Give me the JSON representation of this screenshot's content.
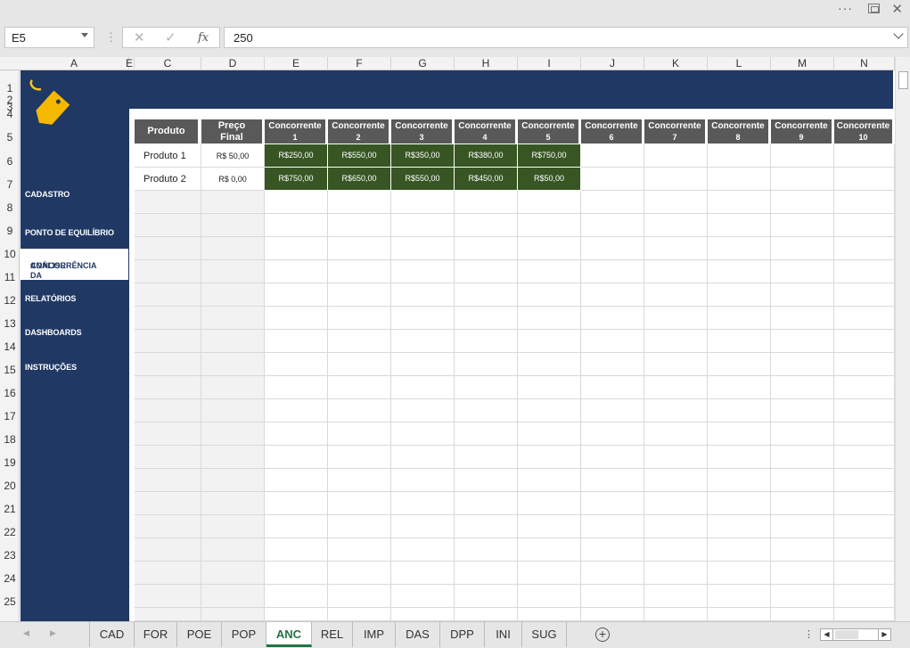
{
  "window": {
    "more": "···",
    "close": "✕"
  },
  "formula": {
    "cell_ref": "E5",
    "cancel": "✕",
    "confirm": "✓",
    "fx": "fx",
    "value": "250"
  },
  "columns": [
    "A",
    "E",
    "C",
    "D",
    "E",
    "F",
    "G",
    "H",
    "I",
    "J",
    "K",
    "L",
    "M",
    "N"
  ],
  "rows": [
    "1",
    "2",
    "3",
    "4",
    "5",
    "6",
    "7",
    "8",
    "9",
    "10",
    "11",
    "12",
    "13",
    "14",
    "15",
    "16",
    "17",
    "18",
    "19",
    "20",
    "21",
    "22",
    "23",
    "24",
    "25"
  ],
  "sidebar": {
    "items": [
      "CADASTRO",
      "PONTO DE EQUILÍBRIO",
      "ANÁLISE DA CONCORRÊNCIA",
      "RELATÓRIOS",
      "DASHBOARDS",
      "INSTRUÇÕES"
    ],
    "active_line1": "ANÁLISE DA",
    "active_line2": "CONCORRÊNCIA",
    "brand_color": "#203864",
    "logo_icon": "price-tag-icon"
  },
  "table": {
    "headers": {
      "produto": "Produto",
      "preco_line1": "Preço",
      "preco_line2": "Final",
      "concorrente": "Concorrente",
      "numbers": [
        "1",
        "2",
        "3",
        "4",
        "5",
        "6",
        "7",
        "8",
        "9",
        "10"
      ]
    },
    "rows": [
      {
        "produto": "Produto 1",
        "preco": "R$ 50,00",
        "concorrentes": [
          "R$250,00",
          "R$550,00",
          "R$350,00",
          "R$380,00",
          "R$750,00"
        ]
      },
      {
        "produto": "Produto 2",
        "preco": "R$ 0,00",
        "concorrentes": [
          "R$750,00",
          "R$650,00",
          "R$550,00",
          "R$450,00",
          "R$50,00"
        ]
      }
    ],
    "header_color": "#595959",
    "value_color": "#375623"
  },
  "tabs": [
    "CAD",
    "FOR",
    "POE",
    "POP",
    "ANC",
    "REL",
    "IMP",
    "DAS",
    "DPP",
    "INI",
    "SUG"
  ],
  "active_tab": "ANC",
  "tab_nav": {
    "prev": "◀",
    "next": "▶",
    "add": "+",
    "more": "⋮"
  }
}
